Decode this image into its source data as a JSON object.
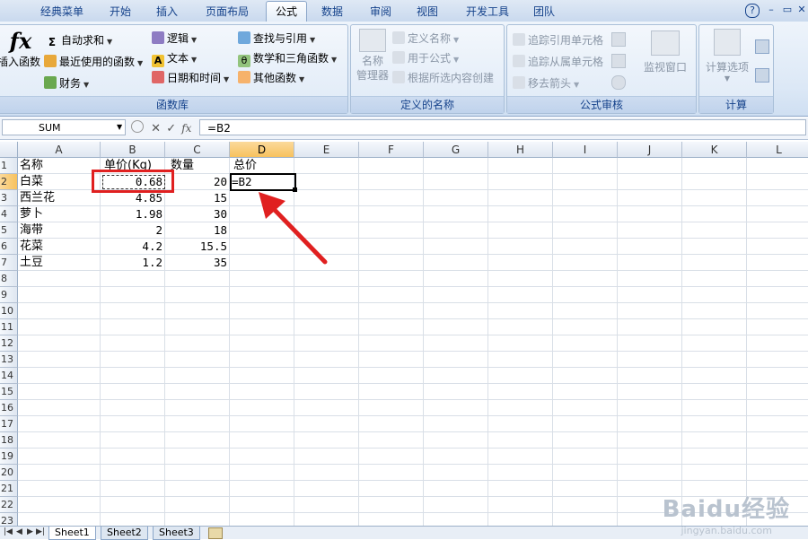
{
  "tabs": [
    "经典菜单",
    "开始",
    "插入",
    "页面布局",
    "公式",
    "数据",
    "审阅",
    "视图",
    "开发工具",
    "团队"
  ],
  "active_tab": "公式",
  "ribbon": {
    "function_library": {
      "insert_function": "插入函数",
      "autosum": "自动求和",
      "recent": "最近使用的函数",
      "financial": "财务",
      "logical": "逻辑",
      "text": "文本",
      "datetime": "日期和时间",
      "lookup": "查找与引用",
      "math": "数学和三角函数",
      "other": "其他函数",
      "label": "函数库"
    },
    "defined_names": {
      "name_manager_1": "名称",
      "name_manager_2": "管理器",
      "define_name": "定义名称",
      "use_in_formula": "用于公式",
      "create_from_selection": "根据所选内容创建",
      "label": "定义的名称"
    },
    "formula_auditing": {
      "trace_precedents": "追踪引用单元格",
      "trace_dependents": "追踪从属单元格",
      "remove_arrows": "移去箭头",
      "watch_window": "监视窗口",
      "label": "公式审核"
    },
    "calculation": {
      "options": "计算选项",
      "label": "计算"
    }
  },
  "formula_bar": {
    "name_box": "SUM",
    "formula": "=B2"
  },
  "columns": [
    "A",
    "B",
    "C",
    "D",
    "E",
    "F",
    "G",
    "H",
    "I",
    "J",
    "K",
    "L"
  ],
  "rows": [
    "1",
    "2",
    "3",
    "4",
    "5",
    "6",
    "7",
    "8",
    "9",
    "10",
    "11",
    "12",
    "13",
    "14",
    "15",
    "16",
    "17",
    "18",
    "19",
    "20",
    "21",
    "22",
    "23"
  ],
  "headers": {
    "a": "名称",
    "b": "单价(Kg)",
    "c": "数量",
    "d": "总价"
  },
  "data_rows": [
    {
      "name": "白菜",
      "price": "0.68",
      "qty": "20"
    },
    {
      "name": "西兰花",
      "price": "4.85",
      "qty": "15"
    },
    {
      "name": "萝卜",
      "price": "1.98",
      "qty": "30"
    },
    {
      "name": "海带",
      "price": "2",
      "qty": "18"
    },
    {
      "name": "花菜",
      "price": "4.2",
      "qty": "15.5"
    },
    {
      "name": "土豆",
      "price": "1.2",
      "qty": "35"
    }
  ],
  "editing_cell": "=B2",
  "sheets": [
    "Sheet1",
    "Sheet2",
    "Sheet3"
  ],
  "colors": {
    "highlight": "#e02020",
    "selected_header": "#f7c25e"
  },
  "watermark": {
    "logo": "Baidu经验",
    "url": "jingyan.baidu.com"
  }
}
